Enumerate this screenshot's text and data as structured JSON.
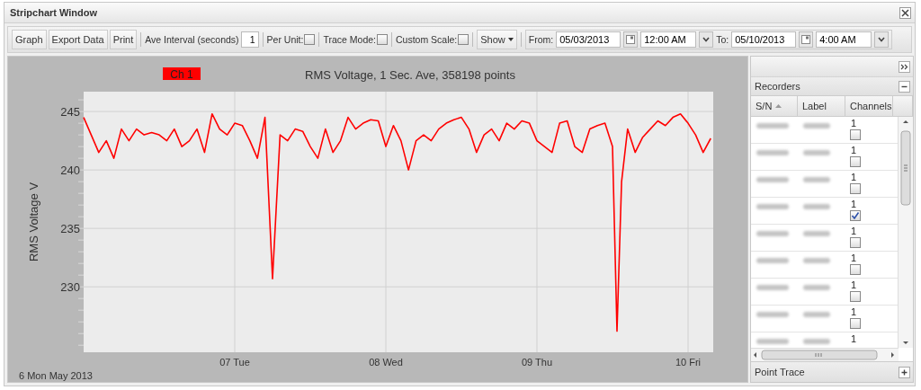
{
  "window": {
    "title": "Stripchart Window"
  },
  "toolbar": {
    "buttons": [
      "Graph",
      "Export Data",
      "Print"
    ],
    "ave_interval": {
      "label": "Ave Interval (seconds)",
      "value": "1"
    },
    "options": [
      {
        "label": "Per Unit:",
        "checked": false
      },
      {
        "label": "Trace Mode:",
        "checked": false
      },
      {
        "label": "Custom Scale:",
        "checked": false
      }
    ],
    "show_menu": "Show",
    "from": {
      "label": "From:",
      "date": "05/03/2013",
      "time": "12:00 AM"
    },
    "to": {
      "label": "To:",
      "date": "05/10/2013",
      "time": "4:00 AM"
    }
  },
  "chart": {
    "start_date": "6 Mon May 2013",
    "chart_data": {
      "type": "line",
      "grid": true,
      "title": "RMS Voltage, 1 Sec. Ave, 358198 points",
      "ylabel": "RMS Voltage V",
      "x": [
        6,
        6.05,
        6.1,
        6.15,
        6.2,
        6.25,
        6.3,
        6.35,
        6.4,
        6.45,
        6.5,
        6.55,
        6.6,
        6.65,
        6.7,
        6.75,
        6.8,
        6.85,
        6.9,
        6.95,
        7.0,
        7.05,
        7.1,
        7.15,
        7.2,
        7.25,
        7.3,
        7.35,
        7.4,
        7.45,
        7.5,
        7.55,
        7.6,
        7.65,
        7.7,
        7.75,
        7.8,
        7.85,
        7.9,
        7.95,
        8.0,
        8.05,
        8.1,
        8.15,
        8.2,
        8.25,
        8.3,
        8.35,
        8.4,
        8.45,
        8.5,
        8.55,
        8.6,
        8.65,
        8.7,
        8.75,
        8.8,
        8.85,
        8.9,
        8.95,
        9.0,
        9.05,
        9.1,
        9.15,
        9.2,
        9.25,
        9.3,
        9.35,
        9.4,
        9.45,
        9.5,
        9.53,
        9.56,
        9.6,
        9.65,
        9.7,
        9.75,
        9.8,
        9.85,
        9.9,
        9.95,
        10.0,
        10.05,
        10.1,
        10.15
      ],
      "series": [
        {
          "name": "Ch 1",
          "color": "#ff0000",
          "values": [
            244.5,
            243,
            241.5,
            242.5,
            241,
            243.5,
            242.5,
            243.5,
            243,
            243.2,
            243,
            242.5,
            243.5,
            242,
            242.5,
            243.5,
            241.5,
            244.8,
            243.5,
            243,
            244,
            243.8,
            242.5,
            241,
            244.5,
            230.7,
            243,
            242.5,
            243.5,
            243.3,
            242,
            241,
            243.5,
            241.5,
            242.5,
            244.5,
            243.5,
            244,
            244.3,
            244.2,
            242,
            243.8,
            242.5,
            240,
            242.5,
            243,
            242.5,
            243.5,
            244,
            244.3,
            244.5,
            243.5,
            241.5,
            243,
            243.5,
            242.5,
            244,
            243.5,
            244.2,
            244,
            242.5,
            242,
            241.5,
            244,
            244.2,
            242,
            241.5,
            243.5,
            243.8,
            244,
            242,
            226.2,
            239,
            243.5,
            241.5,
            242.8,
            243.5,
            244.2,
            243.8,
            244.5,
            244.8,
            244,
            243,
            241.5,
            242.7
          ]
        }
      ],
      "xlim": [
        6,
        10.1667
      ],
      "ylim": [
        224.4,
        246.7
      ],
      "xticks": [
        {
          "value": 7,
          "label": "07 Tue"
        },
        {
          "value": 8,
          "label": "08 Wed"
        },
        {
          "value": 9,
          "label": "09 Thu"
        },
        {
          "value": 10,
          "label": "10 Fri"
        }
      ],
      "yticks": [
        230,
        235,
        240,
        245
      ]
    }
  },
  "side_panel": {
    "recorders": {
      "title": "Recorders",
      "columns": [
        "S/N",
        "Label",
        "Channels"
      ],
      "rows": [
        {
          "channel": "1",
          "checked": false
        },
        {
          "channel": "1",
          "checked": false
        },
        {
          "channel": "1",
          "checked": false
        },
        {
          "channel": "1",
          "checked": true
        },
        {
          "channel": "1",
          "checked": false
        },
        {
          "channel": "1",
          "checked": false
        },
        {
          "channel": "1",
          "checked": false
        },
        {
          "channel": "1",
          "checked": false
        },
        {
          "channel": "1"
        }
      ]
    },
    "point_trace": {
      "title": "Point Trace"
    }
  }
}
